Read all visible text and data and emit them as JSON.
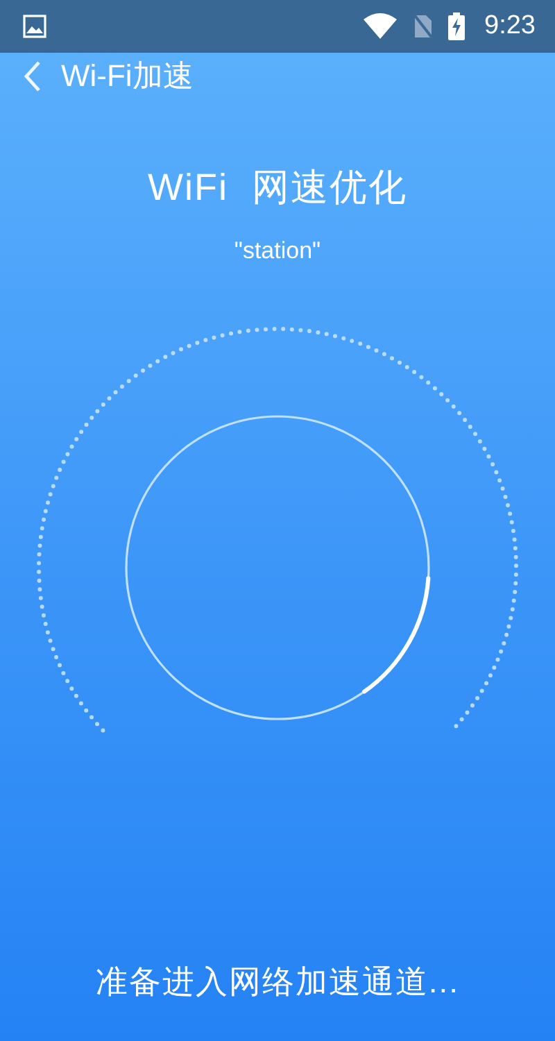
{
  "status_bar": {
    "time": "9:23"
  },
  "app_bar": {
    "title": "Wi-Fi加速"
  },
  "heading": "WiFi  网速优化",
  "network_name": "\"station\"",
  "status_text": "准备进入网络加速通道..."
}
